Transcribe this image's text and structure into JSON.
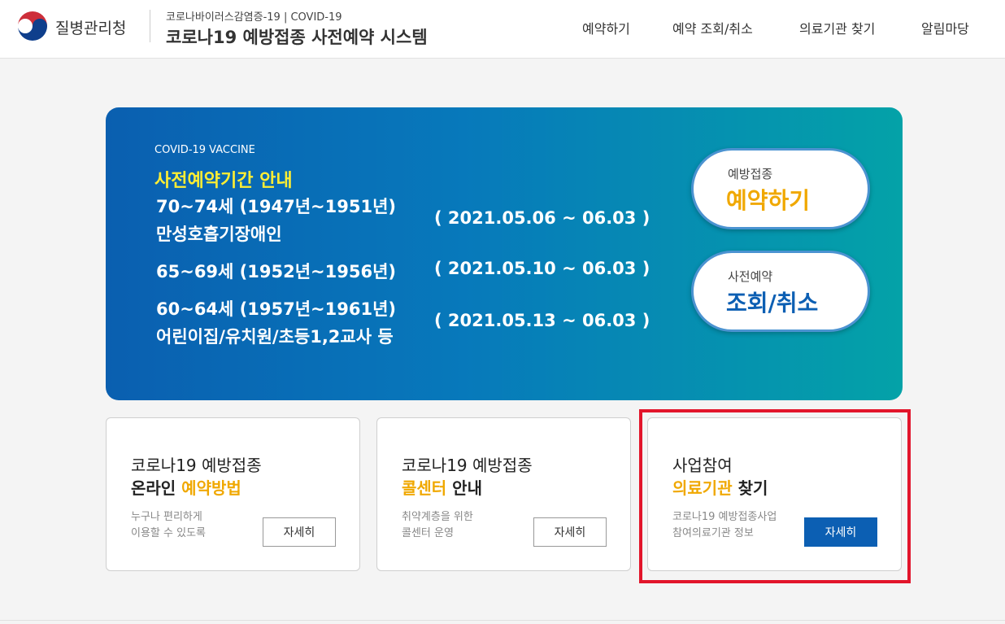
{
  "header": {
    "agency": "질병관리청",
    "sub_title": "코로나바이러스감염증-19 | COVID-19",
    "system_title": "코로나19 예방접종 사전예약 시스템",
    "nav": [
      "예약하기",
      "예약 조회/취소",
      "의료기관 찾기",
      "알림마당"
    ]
  },
  "banner": {
    "tag": "COVID-19 VACCINE",
    "heading": "사전예약기간 안내",
    "groups": [
      {
        "line1": "70~74세 (1947년~1951년)",
        "line2": "만성호흡기장애인",
        "date": "( 2021.05.06 ~ 06.03 )"
      },
      {
        "line1": "65~69세 (1952년~1956년)",
        "line2": "",
        "date": "( 2021.05.10 ~ 06.03 )"
      },
      {
        "line1": "60~64세 (1957년~1961년)",
        "line2": "어린이집/유치원/초등1,2교사 등",
        "date": "( 2021.05.13 ~ 06.03 )"
      }
    ],
    "reserve": {
      "small": "예방접종",
      "big": "예약하기"
    },
    "lookup": {
      "small": "사전예약",
      "big": "조회/취소"
    }
  },
  "cards": [
    {
      "title1": "코로나19 예방접종",
      "title2_strong": "온라인 ",
      "title2_accent": "예약방법",
      "title2_rest": "",
      "desc1": "누구나 편리하게",
      "desc2": "이용할 수 있도록",
      "button": "자세히"
    },
    {
      "title1": "코로나19 예방접종",
      "title2_strong": "",
      "title2_accent": "콜센터",
      "title2_rest": " 안내",
      "desc1": "취약계층을 위한",
      "desc2": "콜센터 운영",
      "button": "자세히"
    },
    {
      "title1": "사업참여",
      "title2_strong": "",
      "title2_accent": "의료기관",
      "title2_rest": " 찾기",
      "desc1": "코로나19 예방접종사업",
      "desc2": "참여의료기관 정보",
      "button": "자세히"
    }
  ],
  "colors": {
    "accent_yellow": "#f0a800",
    "banner_heading": "#ffee33",
    "primary_blue": "#0c5fb3",
    "highlight_red": "#e2152b"
  }
}
